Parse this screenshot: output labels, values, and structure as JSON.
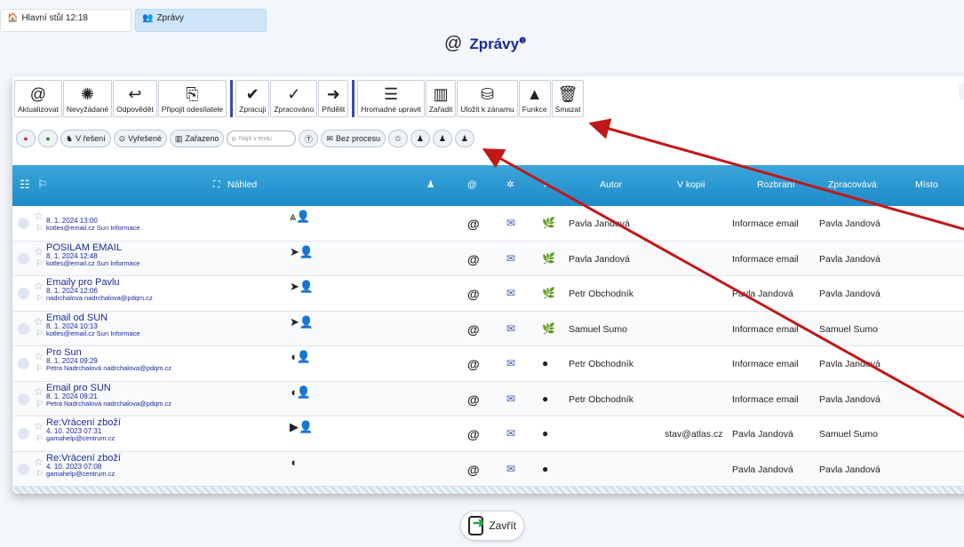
{
  "tabs": {
    "home": {
      "icon": "home-icon",
      "label": "Hlavní stůl 12:18"
    },
    "messages": {
      "icon": "users-icon",
      "label": "Zprávy"
    }
  },
  "page": {
    "title": "Zprávy",
    "title_sup": "❶"
  },
  "toolbar": [
    {
      "id": "refresh",
      "label": "Aktualizovat",
      "icon": "refresh-mail-icon",
      "glyph": "@"
    },
    {
      "id": "spam",
      "label": "Nevyžádané",
      "icon": "spam-icon",
      "glyph": "✺"
    },
    {
      "id": "reply",
      "label": "Odpovědět",
      "icon": "reply-user-icon",
      "glyph": "↩"
    },
    {
      "id": "attach_sender",
      "label": "Připojit odesílatele",
      "icon": "attach-sender-icon",
      "glyph": "⎘"
    },
    {
      "id": "process",
      "label": "Zpracuji",
      "icon": "process-user-icon",
      "glyph": "✔"
    },
    {
      "id": "processed",
      "label": "Zpracováno",
      "icon": "processed-icon",
      "glyph": "✓"
    },
    {
      "id": "assign",
      "label": "Přidělit",
      "icon": "assign-user-icon",
      "glyph": "➜"
    },
    {
      "id": "bulk_edit",
      "label": "Hromadné upravit",
      "icon": "bulk-edit-icon",
      "glyph": "☰"
    },
    {
      "id": "file",
      "label": "Zařadit",
      "icon": "binders-icon",
      "glyph": "▥"
    },
    {
      "id": "save_record",
      "label": "Uložit k zánamu",
      "icon": "save-record-icon",
      "glyph": "⛁"
    },
    {
      "id": "functions",
      "label": "Funkce",
      "icon": "functions-icon",
      "glyph": "▲"
    },
    {
      "id": "delete",
      "label": "Smazat",
      "icon": "trash-icon",
      "glyph": "🗑"
    }
  ],
  "filters": {
    "in_progress": "V řešení",
    "resolved": "Vyřešené",
    "filed": "Zařazeno",
    "search_placeholder": "Najít v textu",
    "no_process": "Bez procesu"
  },
  "columns": {
    "preview": "Náhled",
    "author": "Autor",
    "copy": "V kopii",
    "distribution": "Rozbraní",
    "handler": "Zpracovává",
    "place": "Místo"
  },
  "rows": [
    {
      "subject": "",
      "date": "8. 1. 2024 13:00",
      "sender": "kotles@email.cz Sun Informace",
      "preview": "⩓👤",
      "status": "✉",
      "dir": "🌿",
      "author": "Pavla Jandová",
      "copy": "",
      "dist": "Informace email",
      "handler": "Pavla Jandová"
    },
    {
      "subject": "POSILAM EMAIL",
      "date": "8. 1. 2024 12:48",
      "sender": "kotles@email.cz Sun Informace",
      "preview": "➤👤",
      "status": "✉",
      "dir": "🌿",
      "author": "Pavla Jandová",
      "copy": "",
      "dist": "Informace email",
      "handler": "Pavla Jandová"
    },
    {
      "subject": "Emaily pro Pavlu",
      "date": "8. 1. 2024 12:06",
      "sender": "nadrchalova nadrchalova@pdqm.cz",
      "preview": "➤👤",
      "status": "✉",
      "dir": "🌿",
      "author": "Petr Obchodník",
      "copy": "",
      "dist": "Pavla Jandová",
      "handler": "Pavla Jandová"
    },
    {
      "subject": "Email od SUN",
      "date": "8. 1. 2024 10:13",
      "sender": "kotles@email.cz Sun Informace",
      "preview": "➤👤",
      "status": "✉",
      "dir": "🌿",
      "author": "Samuel Sumo",
      "copy": "",
      "dist": "Informace email",
      "handler": "Samuel Sumo"
    },
    {
      "subject": "Pro Sun",
      "date": "8. 1. 2024 09:29",
      "sender": "Petra Nadrchalová nadrchalova@pdqm.cz",
      "preview": "◖👤",
      "status": "✉",
      "dir": "●",
      "author": "Petr Obchodník",
      "copy": "",
      "dist": "Informace email",
      "handler": "Pavla Jandová"
    },
    {
      "subject": "Email pro SUN",
      "date": "8. 1. 2024 09:21",
      "sender": "Petra Nadrchalová nadrchalova@pdqm.cz",
      "preview": "◖👤",
      "status": "✉",
      "dir": "●",
      "author": "Petr Obchodník",
      "copy": "",
      "dist": "Informace email",
      "handler": "Pavla Jandová"
    },
    {
      "subject": "Re:Vrácení zboží",
      "date": "4. 10. 2023 07:31",
      "sender": "gamahelp@centrum.cz",
      "preview": "▶👤",
      "status": "✉",
      "dir": "●",
      "author": "",
      "copy": "stav@atlas.cz",
      "dist": "Pavla Jandová",
      "handler": "Samuel Sumo"
    },
    {
      "subject": "Re:Vrácení zboží",
      "date": "4. 10. 2023 07:08",
      "sender": "gamahelp@centrum.cz",
      "preview": "◖",
      "status": "✉",
      "dir": "●",
      "author": "",
      "copy": "",
      "dist": "Pavla Jandová",
      "handler": "Pavla Jandová"
    }
  ],
  "footer": {
    "close_label": "Zavřít"
  },
  "colors": {
    "header": "#2a96d2",
    "accent": "#1a2a9a",
    "arrow": "#c01818"
  }
}
